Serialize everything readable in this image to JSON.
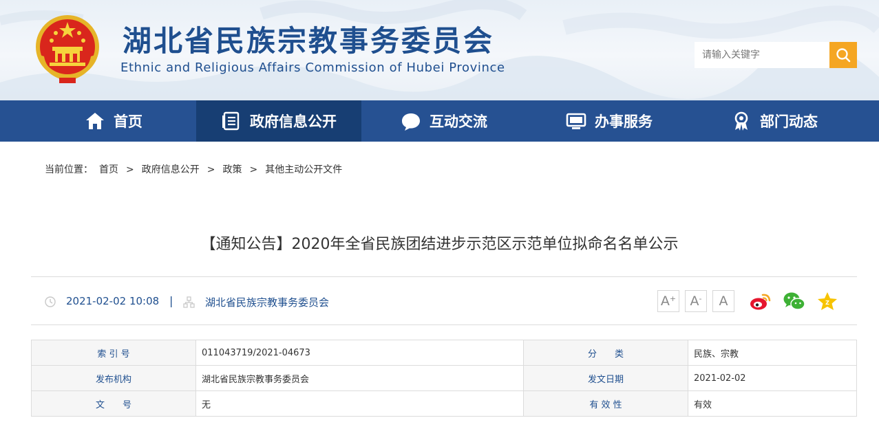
{
  "header": {
    "site_title": "湖北省民族宗教事务委员会",
    "site_subtitle": "Ethnic and Religious Affairs Commission of Hubei Province",
    "search_placeholder": "请输入关键字"
  },
  "nav": {
    "items": [
      {
        "label": "首页",
        "icon": "home-icon"
      },
      {
        "label": "政府信息公开",
        "icon": "document-list-icon"
      },
      {
        "label": "互动交流",
        "icon": "chat-bubble-icon"
      },
      {
        "label": "办事服务",
        "icon": "monitor-icon"
      },
      {
        "label": "部门动态",
        "icon": "award-badge-icon"
      }
    ],
    "active_index": 1
  },
  "breadcrumb": {
    "prefix": "当前位置：",
    "items": [
      "首页",
      "政府信息公开",
      "政策",
      "其他主动公开文件"
    ],
    "separator": ">"
  },
  "article": {
    "title": "【通知公告】2020年全省民族团结进步示范区示范单位拟命名名单公示",
    "date": "2021-02-02 10:08",
    "divider": "|",
    "source": "湖北省民族宗教事务委员会"
  },
  "font_size_buttons": [
    "A",
    "A",
    "A"
  ],
  "font_size_marks": [
    "+",
    "-",
    ""
  ],
  "share_icons": [
    "weibo-icon",
    "wechat-icon",
    "favorite-star-icon"
  ],
  "info_table": {
    "rows": [
      {
        "k1": "索 引 号",
        "v1": "011043719/2021-04673",
        "k2": "分　　类",
        "v2": "民族、宗教"
      },
      {
        "k1": "发布机构",
        "v1": "湖北省民族宗教事务委员会",
        "k2": "发文日期",
        "v2": "2021-02-02"
      },
      {
        "k1": "文　　号",
        "v1": "无",
        "k2": "有 效 性",
        "v2": "有效"
      }
    ]
  },
  "colors": {
    "brand_blue": "#265192",
    "nav_active": "#173e73",
    "search_button": "#f5a623",
    "link_blue": "#1f4f8f"
  }
}
